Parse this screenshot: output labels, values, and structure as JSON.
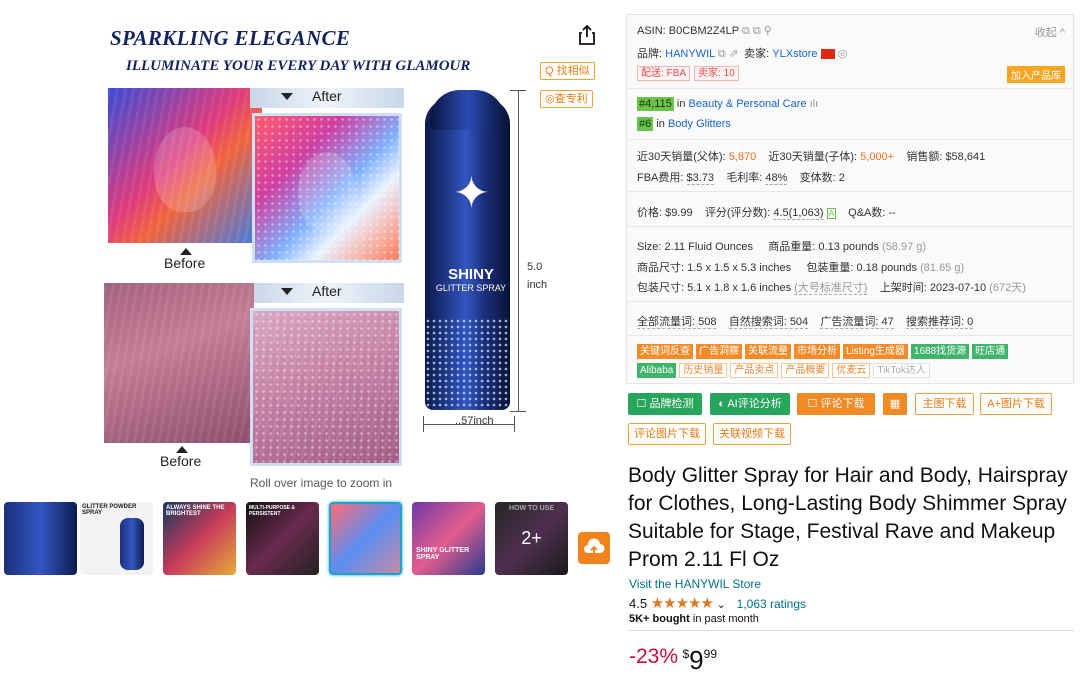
{
  "image": {
    "headline": "SPARKLING ELEGANCE",
    "subheadline": "ILLUMINATE YOUR EVERY DAY WITH GLAMOUR",
    "before_label": "Before",
    "after_label": "After",
    "can_brand": "SHINY",
    "can_product": "GLITTER SPRAY",
    "height_dim": "5.0",
    "height_unit": "inch",
    "width_dim": "..57inch",
    "zoom_hint": "Roll over image to zoom in",
    "find_similar": "Q 找相似",
    "check_patent": "◎查专利"
  },
  "thumbnails": [
    {
      "name": "thumb-1",
      "caption": ""
    },
    {
      "name": "thumb-2",
      "caption": "GLITTER POWDER SPRAY"
    },
    {
      "name": "thumb-3",
      "caption": "ALWAYS SHINE THE BRIGHTEST"
    },
    {
      "name": "thumb-4",
      "caption": "MULTI-PURPOSE & PERSISTENT"
    },
    {
      "name": "thumb-5",
      "caption": ""
    },
    {
      "name": "thumb-6",
      "caption": "SHINY GLITTER SPRAY"
    },
    {
      "name": "thumb-7",
      "caption": "HOW TO USE",
      "overlay": "2+"
    }
  ],
  "panel": {
    "asin_label": "ASIN: B0CBM2Z4LP",
    "collapse": "收起 ^",
    "brand_label": "品牌:",
    "brand_value": "HANYWIL",
    "seller_label": "卖家:",
    "seller_value": "YLXstore",
    "fba_tag": "配送: FBA",
    "seller_count_tag": "卖家: 10",
    "add_to_lib": "加入产品库",
    "rank1_num": "#4,115",
    "rank1_in": "in",
    "rank1_cat": "Beauty & Personal Care",
    "rank2_num": "#6",
    "rank2_in": "in",
    "rank2_cat": "Body Glitters",
    "sales30_parent_label": "近30天销量(父体):",
    "sales30_parent": "5,870",
    "sales30_child_label": "近30天销量(子体):",
    "sales30_child": "5,000+",
    "revenue": "销售额: $58,641",
    "fba_fee_label": "FBA费用:",
    "fba_fee": "$3.73",
    "margin_label": "毛利率:",
    "margin": "48%",
    "variants": "变体数: 2",
    "price_label": "价格:",
    "price": "$9.99",
    "rating_label": "评分(评分数):",
    "rating": "4.5(1,063)",
    "qa": "Q&A数: --",
    "size_label": "Size:",
    "size": "2.11 Fluid Ounces",
    "weight_label": "商品重量:",
    "weight": "0.13 pounds",
    "weight_g": "(58.97 g)",
    "dims_label": "商品尺寸:",
    "dims": "1.5 x 1.5 x 5.3 inches",
    "pkg_weight_label": "包装重量:",
    "pkg_weight": "0.18 pounds",
    "pkg_weight_g": "(81.65 g)",
    "pkg_dims_label": "包装尺寸:",
    "pkg_dims": "5.1 x 1.8 x 1.6 inches",
    "pkg_dims_note": "(大号标准尺寸)",
    "listed_label": "上架时间:",
    "listed": "2023-07-10",
    "listed_days": "(672天)",
    "traffic_total": "全部流量词: 508",
    "traffic_natural": "自然搜索词: 504",
    "traffic_ad": "广告流量词: 47",
    "traffic_rec": "搜索推荐词: 0",
    "tools_row1": [
      {
        "label": "关键词反查",
        "style": "orange"
      },
      {
        "label": "广告洞察",
        "style": "orange"
      },
      {
        "label": "关联流量",
        "style": "orange"
      },
      {
        "label": "市场分析",
        "style": "orange"
      },
      {
        "label": "Listing生成器",
        "style": "orange"
      },
      {
        "label": "1688找货源",
        "style": "green"
      },
      {
        "label": "旺店通",
        "style": "green"
      }
    ],
    "tools_row2": [
      {
        "label": "Alibaba",
        "style": "green"
      },
      {
        "label": "历史销量",
        "style": "outline"
      },
      {
        "label": "产品卖点",
        "style": "outline"
      },
      {
        "label": "产品概要",
        "style": "outline"
      },
      {
        "label": "优麦云",
        "style": "outline"
      },
      {
        "label": "TikTok达人",
        "style": "outline-gray"
      }
    ]
  },
  "actions": {
    "brand_check": "☐ 品牌检测",
    "ai_review": "◐ AI评论分析",
    "review_download": "☐ 评论下载",
    "main_img_download": "主图下载",
    "aplus_download": "A+图片下载",
    "review_img_download": "评论图片下载",
    "video_download": "关联视频下载"
  },
  "product": {
    "title": "Body Glitter Spray for Hair and Body, Hairspray for Clothes, Long-Lasting Body Shimmer Spray Suitable for Stage, Festival Rave and Makeup Prom 2.11 Fl Oz",
    "store": "Visit the HANYWIL Store",
    "rating_value": "4.5",
    "stars": "★★★★★",
    "ratings_count": "1,063 ratings",
    "bought_bold": "5K+ bought",
    "bought_rest": "in past month",
    "discount": "-23%",
    "currency": "$",
    "price_whole": "9",
    "price_fraction": "99"
  },
  "colors": {
    "accent_orange": "#f08a24",
    "accent_green": "#26a65b",
    "link_blue": "#1a64c9",
    "amazon_link": "#007185",
    "discount_red": "#cc0c39",
    "star": "#de7921"
  }
}
